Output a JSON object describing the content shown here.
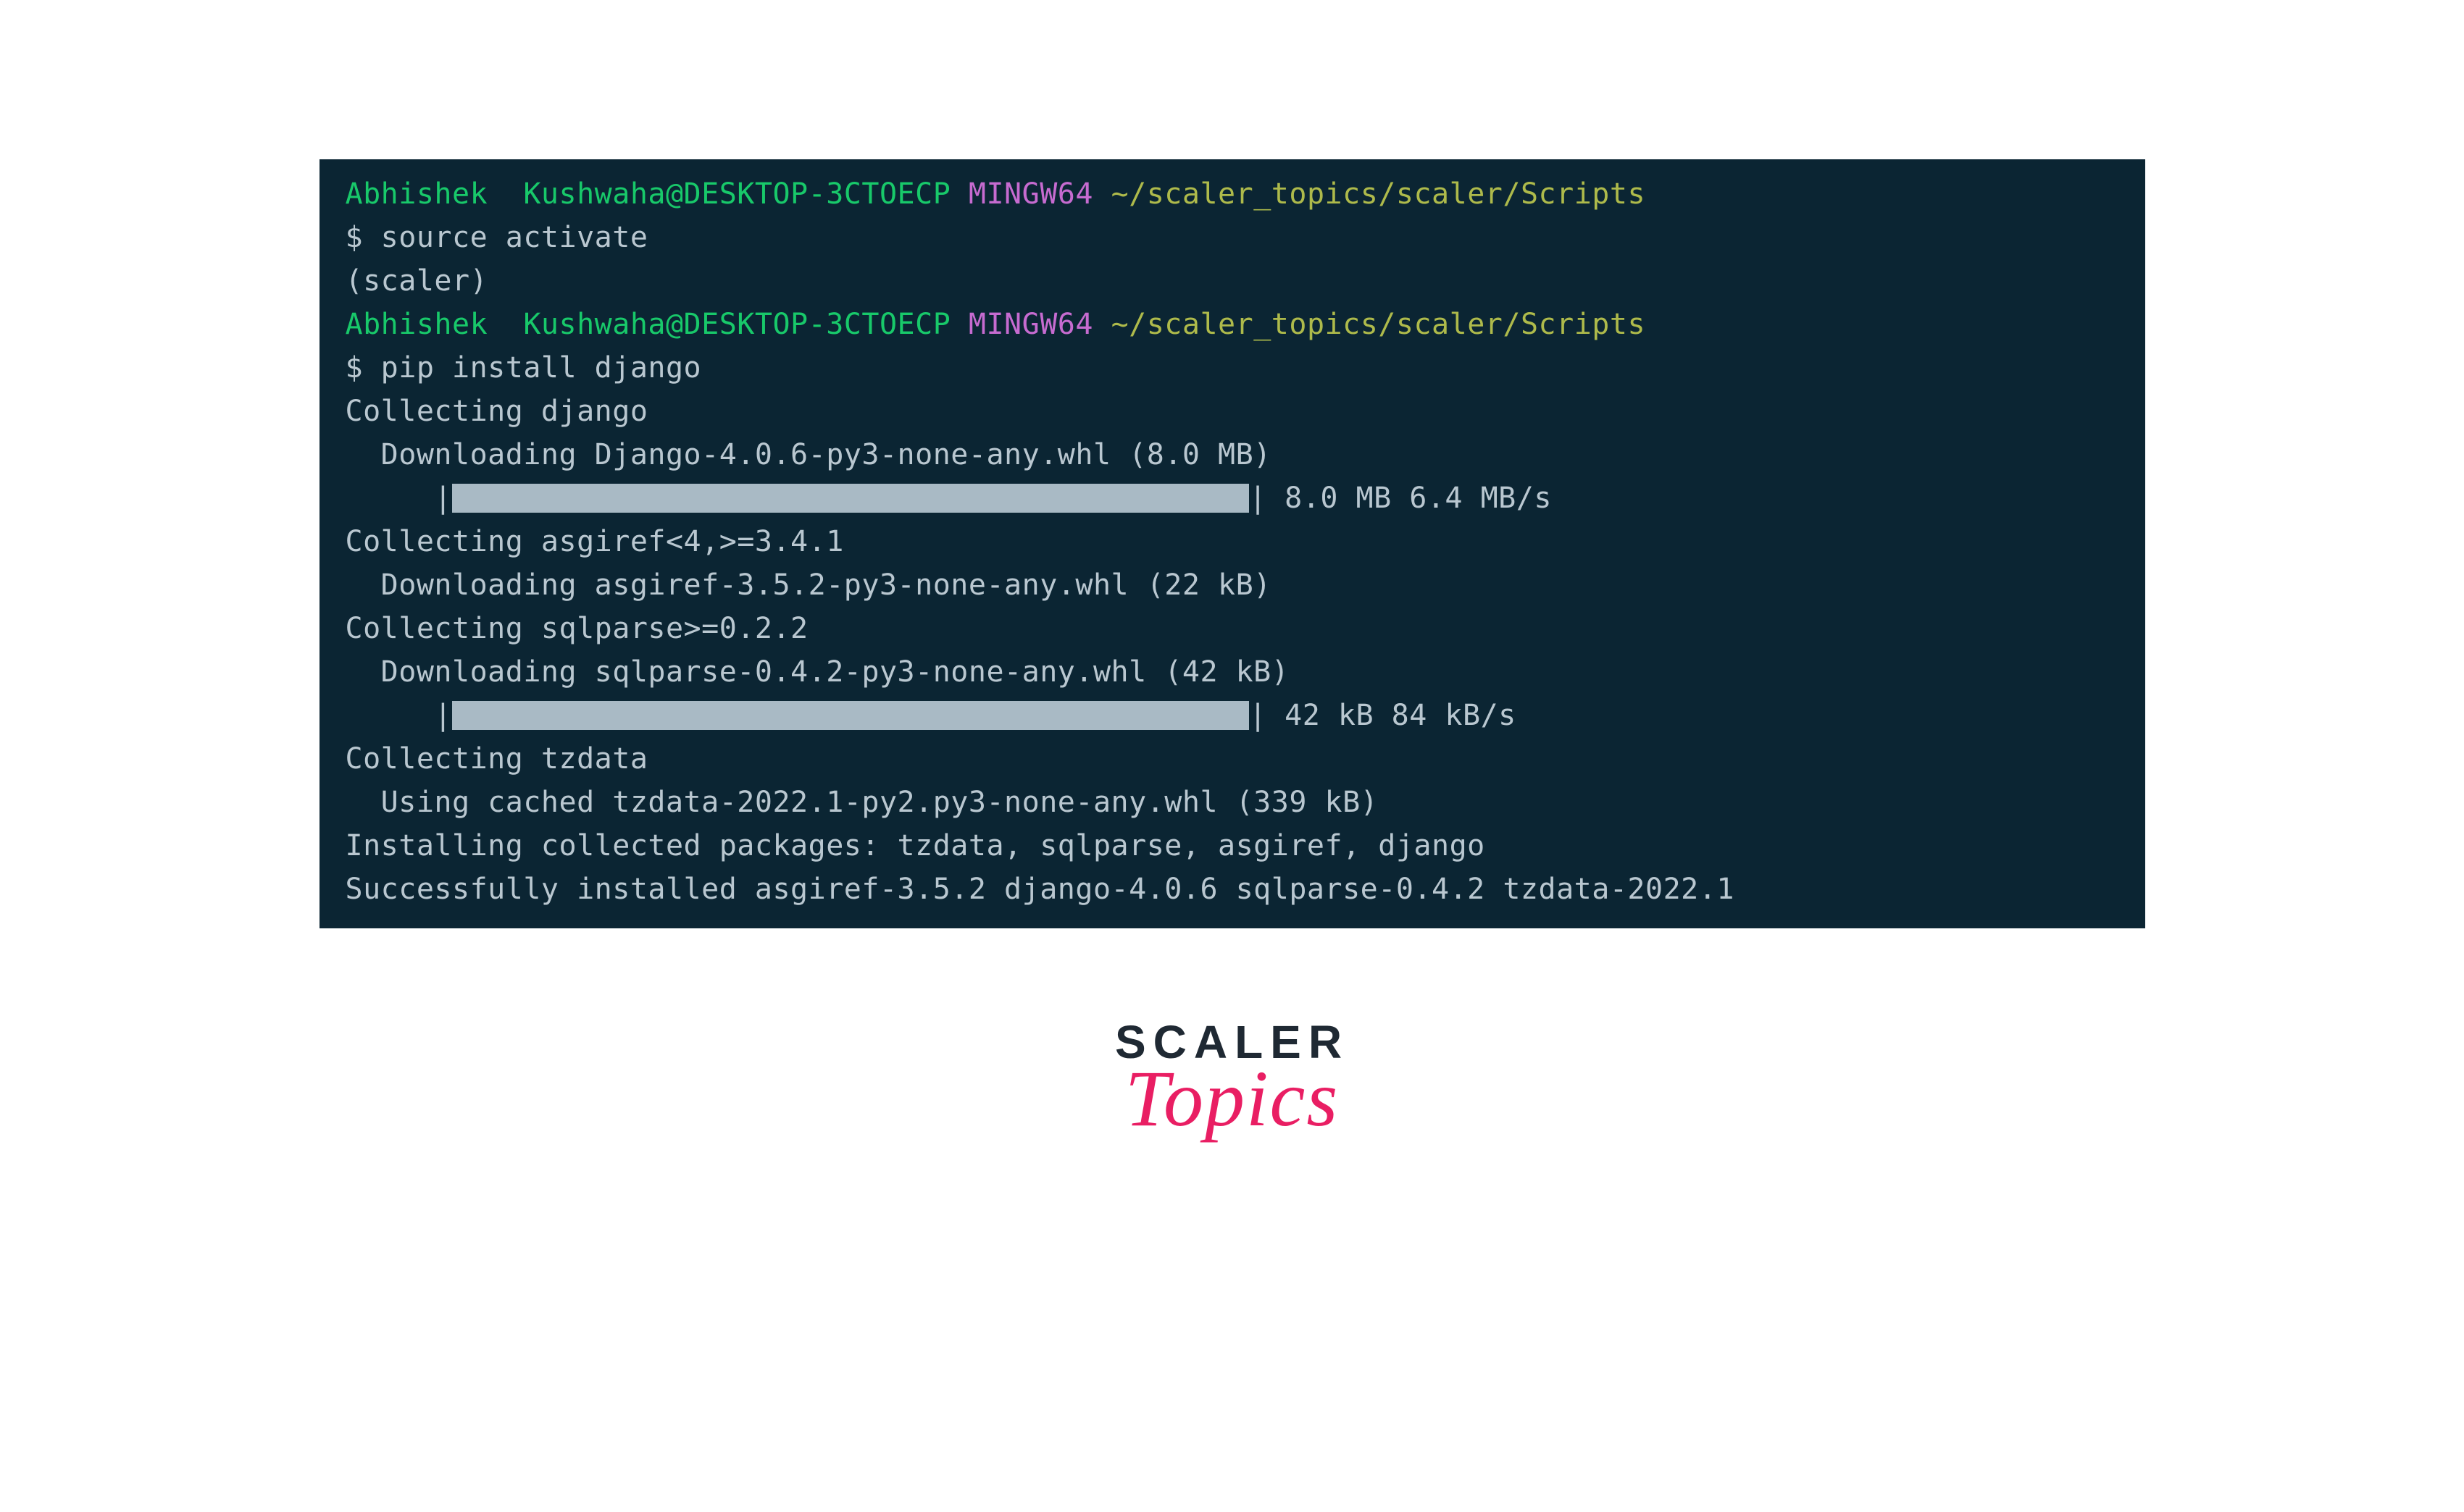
{
  "colors": {
    "terminal_bg": "#0b2533",
    "user_green": "#18c96a",
    "shell_magenta": "#c66bd0",
    "path_olive": "#aeba4b",
    "text_default": "#b9c7d0",
    "brand_accent": "#e91e63"
  },
  "prompt1": {
    "user": "Abhishek  Kushwaha@DESKTOP-3CTOECP",
    "shell": "MINGW64",
    "path": "~/scaler_topics/scaler/Scripts",
    "command": "$ source activate",
    "venv": "(scaler)"
  },
  "prompt2": {
    "user": "Abhishek  Kushwaha@DESKTOP-3CTOECP",
    "shell": "MINGW64",
    "path": "~/scaler_topics/scaler/Scripts",
    "command": "$ pip install django"
  },
  "output": {
    "l1": "Collecting django",
    "l2": "  Downloading Django-4.0.6-py3-none-any.whl (8.0 MB)",
    "l3_prefix": "     |",
    "l3_suffix": "| 8.0 MB 6.4 MB/s",
    "l4": "Collecting asgiref<4,>=3.4.1",
    "l5": "  Downloading asgiref-3.5.2-py3-none-any.whl (22 kB)",
    "l6": "Collecting sqlparse>=0.2.2",
    "l7": "  Downloading sqlparse-0.4.2-py3-none-any.whl (42 kB)",
    "l8_prefix": "     |",
    "l8_suffix": "| 42 kB 84 kB/s",
    "l9": "Collecting tzdata",
    "l10": "  Using cached tzdata-2022.1-py2.py3-none-any.whl (339 kB)",
    "l11": "Installing collected packages: tzdata, sqlparse, asgiref, django",
    "l12": "Successfully installed asgiref-3.5.2 django-4.0.6 sqlparse-0.4.2 tzdata-2022.1"
  },
  "brand": {
    "title": "SCALER",
    "subtitle": "Topics"
  }
}
